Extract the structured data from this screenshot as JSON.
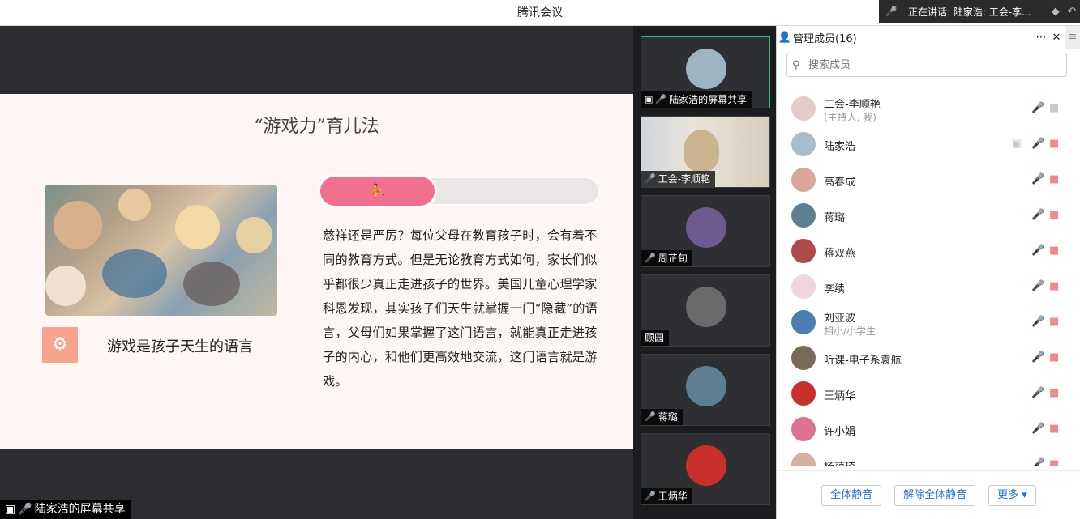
{
  "window": {
    "title": "腾讯会议"
  },
  "speaking": {
    "text": "正在讲话: 陆家浩; 工会-李..."
  },
  "slide": {
    "title": "“游戏力”育儿法",
    "caption": "游戏是孩子天生的语言",
    "progress": 0.41,
    "body": "慈祥还是严厉？每位父母在教育孩子时，会有着不同的教育方式。但是无论教育方式如何，家长们似乎都很少真正走进孩子的世界。美国儿童心理学家科恩发现，其实孩子们天生就掌握一门“隐藏”的语言，父母们如果掌握了这门语言，就能真正走进孩子的内心，和他们更高效地交流，这门语言就是游戏。"
  },
  "share_label": "陆家浩的屏幕共享",
  "video_tiles": [
    {
      "label": "陆家浩的屏幕共享",
      "active": true,
      "muted": false,
      "avatar_color": "#9fb4c3",
      "kind": "screen"
    },
    {
      "label": "工会-李顺艳",
      "active": false,
      "muted": false,
      "avatar_color": "#c9b48f",
      "kind": "camera"
    },
    {
      "label": "周芷旬",
      "active": false,
      "muted": true,
      "avatar_color": "#6d5a8e",
      "kind": "avatar"
    },
    {
      "label": "顾园",
      "active": false,
      "muted": false,
      "avatar_color": "#6a6a6a",
      "kind": "plain"
    },
    {
      "label": "蒋璐",
      "active": false,
      "muted": true,
      "avatar_color": "#5e7f92",
      "kind": "avatar"
    },
    {
      "label": "王炳华",
      "active": false,
      "muted": true,
      "avatar_color": "#c9302c",
      "kind": "avatar"
    }
  ],
  "members": {
    "header": "管理成员(16)",
    "search_placeholder": "搜索成员",
    "list": [
      {
        "name": "工会-李顺艳",
        "sub": "(主持人, 我)",
        "mic": "off-gray",
        "share": false,
        "avatar_color": "#e6c9c9"
      },
      {
        "name": "陆家浩",
        "sub": "",
        "mic": "green",
        "share": true,
        "avatar_color": "#a8bccb"
      },
      {
        "name": "高春成",
        "sub": "",
        "mic": "muted",
        "share": false,
        "avatar_color": "#d9a69a"
      },
      {
        "name": "蒋璐",
        "sub": "",
        "mic": "muted",
        "share": false,
        "avatar_color": "#5e7f92"
      },
      {
        "name": "蒋双燕",
        "sub": "",
        "mic": "muted",
        "share": false,
        "avatar_color": "#b04a4a"
      },
      {
        "name": "李续",
        "sub": "",
        "mic": "muted",
        "share": false,
        "avatar_color": "#f0d5dc"
      },
      {
        "name": "刘亚波",
        "sub": "相小/小学生",
        "mic": "muted",
        "share": false,
        "avatar_color": "#4a7fb0"
      },
      {
        "name": "听课-电子系袁航",
        "sub": "",
        "mic": "muted",
        "share": false,
        "avatar_color": "#7a6a5a"
      },
      {
        "name": "王炳华",
        "sub": "",
        "mic": "muted",
        "share": false,
        "avatar_color": "#c9302c"
      },
      {
        "name": "许小娟",
        "sub": "",
        "mic": "muted",
        "share": false,
        "avatar_color": "#e07090"
      },
      {
        "name": "杨蕴琦",
        "sub": "",
        "mic": "muted",
        "share": false,
        "avatar_color": "#d8b0a0"
      }
    ],
    "footer": {
      "mute_all": "全体静音",
      "unmute_all": "解除全体静音",
      "more": "更多 ▾"
    }
  },
  "icons": {
    "mic": "mic-icon",
    "camera": "camera-icon",
    "share": "screen-share-icon",
    "search": "search-icon",
    "person": "person-icon",
    "close": "close-icon",
    "more": "more-icon"
  }
}
